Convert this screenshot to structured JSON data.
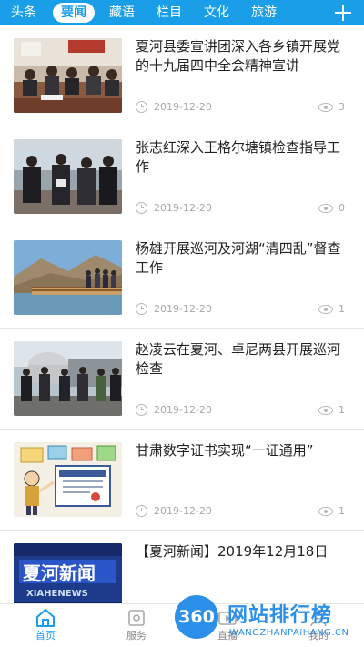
{
  "tabs": [
    {
      "label": "头条",
      "active": false
    },
    {
      "label": "要闻",
      "active": true
    },
    {
      "label": "藏语",
      "active": false
    },
    {
      "label": "栏目",
      "active": false
    },
    {
      "label": "文化",
      "active": false
    },
    {
      "label": "旅游",
      "active": false
    }
  ],
  "add_tab_icon": "plus-icon",
  "news": [
    {
      "title": "夏河县委宣讲团深入各乡镇开展党的十九届四中全会精神宣讲",
      "date": "2019-12-20",
      "views": "3",
      "thumb": "meeting-room"
    },
    {
      "title": "张志红深入王格尔塘镇检查指导工作",
      "date": "2019-12-20",
      "views": "0",
      "thumb": "officials-outdoor"
    },
    {
      "title": "杨雄开展巡河及河湖“清四乱”督查工作",
      "date": "2019-12-20",
      "views": "1",
      "thumb": "river-bridge"
    },
    {
      "title": "赵凌云在夏河、卓尼两县开展巡河检查",
      "date": "2019-12-20",
      "views": "1",
      "thumb": "officials-tanks"
    },
    {
      "title": "甘肃数字证书实现“一证通用”",
      "date": "2019-12-20",
      "views": "1",
      "thumb": "cartoon-certificate"
    },
    {
      "title": "【夏河新闻】2019年12月18日",
      "date": "",
      "views": "",
      "thumb": "xiahe-news-logo",
      "thumb_text": "XIAHENEWS"
    }
  ],
  "bottom_nav": [
    {
      "label": "首页",
      "icon": "home-icon",
      "active": true
    },
    {
      "label": "服务",
      "icon": "service-icon",
      "active": false
    },
    {
      "label": "直播",
      "icon": "live-icon",
      "active": false
    },
    {
      "label": "我的",
      "icon": "user-icon",
      "active": false
    }
  ],
  "watermark": {
    "badge": "360",
    "title": "网站排行榜",
    "url": "WANGZHANPAIHANG.CN"
  },
  "colors": {
    "brand": "#1a9ee8",
    "watermark": "#2c8fe8",
    "text": "#222222",
    "meta": "#a8a8a8"
  }
}
